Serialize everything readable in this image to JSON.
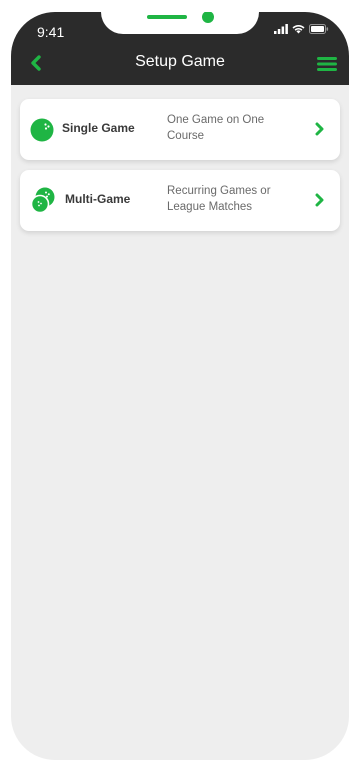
{
  "status_bar": {
    "time": "9:41",
    "icons": [
      "signal-icon",
      "wifi-icon",
      "battery-icon"
    ]
  },
  "navbar": {
    "title": "Setup Game",
    "back_icon": "chevron-left-icon",
    "menu_icon": "hamburger-menu-icon"
  },
  "options": [
    {
      "label": "Single Game",
      "description": "One Game on One Course",
      "icon": "single-ball-icon"
    },
    {
      "label": "Multi-Game",
      "description": "Recurring Games or League Matches",
      "icon": "multi-ball-icon"
    }
  ],
  "colors": {
    "accent": "#1fb544",
    "header_bg": "#2b2b2b",
    "content_bg": "#eeeeee",
    "card_bg": "#ffffff"
  }
}
